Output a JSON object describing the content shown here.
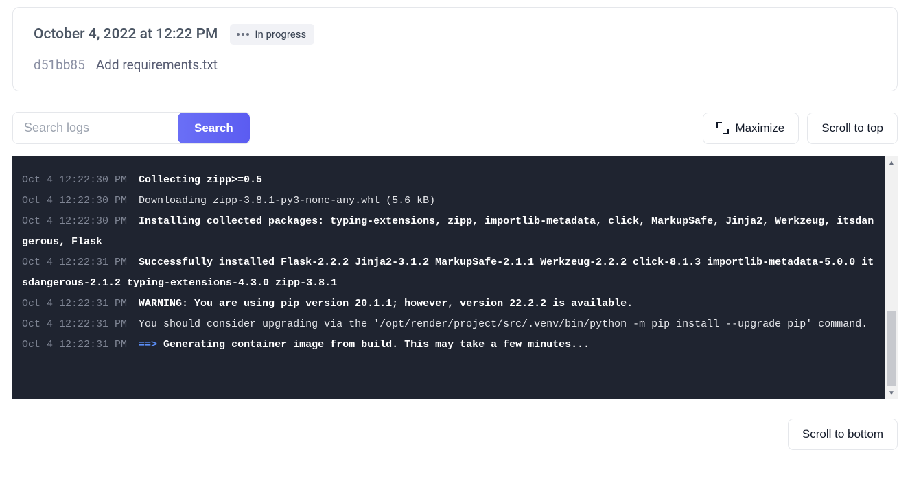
{
  "deploy": {
    "time": "October 4, 2022 at 12:22 PM",
    "status_label": "In progress",
    "commit_hash": "d51bb85",
    "commit_message": "Add requirements.txt"
  },
  "search": {
    "placeholder": "Search logs",
    "button": "Search"
  },
  "actions": {
    "maximize": "Maximize",
    "scroll_top": "Scroll to top",
    "scroll_bottom": "Scroll to bottom"
  },
  "logs": [
    {
      "ts": "Oct 4 12:22:30 PM",
      "msg": "Collecting zipp>=0.5",
      "style": "bold"
    },
    {
      "ts": "Oct 4 12:22:30 PM",
      "msg": "  Downloading zipp-3.8.1-py3-none-any.whl (5.6 kB)",
      "style": "indent"
    },
    {
      "ts": "Oct 4 12:22:30 PM",
      "msg": "Installing collected packages: typing-extensions, zipp, importlib-metadata, click, MarkupSafe, Jinja2, Werkzeug, itsdangerous, Flask",
      "style": "bold"
    },
    {
      "ts": "Oct 4 12:22:31 PM",
      "msg": "Successfully installed Flask-2.2.2 Jinja2-3.1.2 MarkupSafe-2.1.1 Werkzeug-2.2.2 click-8.1.3 importlib-metadata-5.0.0 itsdangerous-2.1.2 typing-extensions-4.3.0 zipp-3.8.1",
      "style": "bold"
    },
    {
      "ts": "Oct 4 12:22:31 PM",
      "msg": "WARNING: You are using pip version 20.1.1; however, version 22.2.2 is available.",
      "style": "bold"
    },
    {
      "ts": "Oct 4 12:22:31 PM",
      "msg": "You should consider upgrading via the '/opt/render/project/src/.venv/bin/python -m pip install --upgrade pip' command.",
      "style": "dim"
    },
    {
      "ts": "Oct 4 12:22:31 PM",
      "msg": "Generating container image from build. This may take a few minutes...",
      "style": "arrow"
    }
  ]
}
